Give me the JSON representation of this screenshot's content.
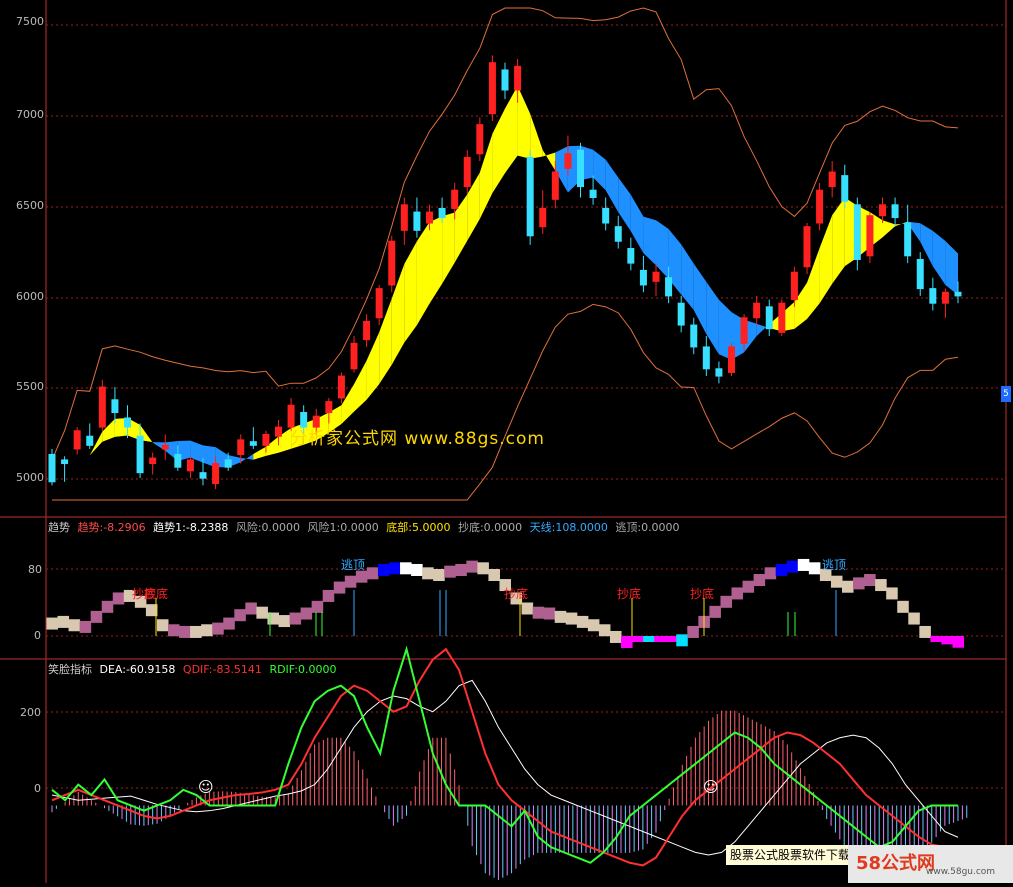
{
  "main_chart": {
    "y_ticks": [
      "7500",
      "7000",
      "6500",
      "6000",
      "5500",
      "5000"
    ],
    "watermark": "分析家公式网 www.88gs.com",
    "side_tag": "5"
  },
  "panel2": {
    "legend": {
      "title": "趋势",
      "items": [
        {
          "text": "趋势:-8.2906",
          "color": "#ff4a4a"
        },
        {
          "text": "趋势1:-8.2388",
          "color": "#ffffff"
        },
        {
          "text": "风险:0.0000",
          "color": "#aaaaaa"
        },
        {
          "text": "风险1:0.0000",
          "color": "#aaaaaa"
        },
        {
          "text": "底部:5.0000",
          "color": "#ffe000"
        },
        {
          "text": "抄底:0.0000",
          "color": "#aaaaaa"
        },
        {
          "text": "天线:108.0000",
          "color": "#33aaff"
        },
        {
          "text": "逃顶:0.0000",
          "color": "#aaaaaa"
        }
      ]
    },
    "y_ticks": [
      "80",
      "0"
    ],
    "annotations": {
      "chaodi": "抄底",
      "taoding": "逃顶"
    }
  },
  "panel3": {
    "legend": {
      "title": "笑脸指标",
      "items": [
        {
          "text": "DEA:-60.9158",
          "color": "#ffffff"
        },
        {
          "text": "QDIF:-83.5141",
          "color": "#ff3030"
        },
        {
          "text": "RDIF:0.0000",
          "color": "#33ff33"
        }
      ]
    },
    "y_ticks": [
      "200",
      "0"
    ],
    "smile": "☺"
  },
  "footer": {
    "banner": "股票公式股票软件下载",
    "logo": "58公式网",
    "url": "www.58gu.com"
  },
  "chart_data": [
    {
      "type": "candlestick",
      "title": "",
      "ylim": [
        4900,
        7600
      ],
      "candles": [
        [
          5150,
          5180,
          4980,
          5000
        ],
        [
          5120,
          5140,
          5000,
          5100
        ],
        [
          5180,
          5300,
          5150,
          5280
        ],
        [
          5250,
          5320,
          5180,
          5200
        ],
        [
          5300,
          5560,
          5280,
          5520
        ],
        [
          5450,
          5520,
          5320,
          5380
        ],
        [
          5350,
          5420,
          5240,
          5300
        ],
        [
          5250,
          5320,
          5020,
          5050
        ],
        [
          5100,
          5160,
          5040,
          5130
        ],
        [
          5180,
          5260,
          5120,
          5200
        ],
        [
          5150,
          5200,
          5060,
          5080
        ],
        [
          5060,
          5140,
          5020,
          5120
        ],
        [
          5050,
          5130,
          4980,
          5020
        ],
        [
          4990,
          5140,
          4960,
          5100
        ],
        [
          5120,
          5160,
          5060,
          5080
        ],
        [
          5150,
          5260,
          5100,
          5230
        ],
        [
          5220,
          5300,
          5180,
          5200
        ],
        [
          5200,
          5280,
          5160,
          5260
        ],
        [
          5250,
          5340,
          5200,
          5300
        ],
        [
          5300,
          5460,
          5280,
          5420
        ],
        [
          5380,
          5420,
          5260,
          5300
        ],
        [
          5300,
          5400,
          5260,
          5360
        ],
        [
          5380,
          5460,
          5320,
          5440
        ],
        [
          5460,
          5600,
          5430,
          5580
        ],
        [
          5620,
          5800,
          5600,
          5760
        ],
        [
          5780,
          5920,
          5740,
          5880
        ],
        [
          5900,
          6080,
          5860,
          6060
        ],
        [
          6080,
          6350,
          6040,
          6320
        ],
        [
          6380,
          6560,
          6300,
          6520
        ],
        [
          6480,
          6560,
          6340,
          6380
        ],
        [
          6420,
          6520,
          6380,
          6480
        ],
        [
          6500,
          6560,
          6420,
          6450
        ],
        [
          6500,
          6640,
          6440,
          6600
        ],
        [
          6620,
          6820,
          6580,
          6780
        ],
        [
          6800,
          7000,
          6760,
          6960
        ],
        [
          7020,
          7340,
          6980,
          7300
        ],
        [
          7260,
          7300,
          7100,
          7150
        ],
        [
          7150,
          7320,
          7080,
          7280
        ],
        [
          6780,
          6820,
          6300,
          6350
        ],
        [
          6400,
          6600,
          6360,
          6500
        ],
        [
          6550,
          6760,
          6500,
          6700
        ],
        [
          6720,
          6900,
          6680,
          6800
        ],
        [
          6820,
          6860,
          6560,
          6620
        ],
        [
          6600,
          6680,
          6520,
          6560
        ],
        [
          6500,
          6560,
          6380,
          6420
        ],
        [
          6400,
          6460,
          6280,
          6320
        ],
        [
          6280,
          6340,
          6160,
          6200
        ],
        [
          6160,
          6240,
          6040,
          6080
        ],
        [
          6100,
          6200,
          6020,
          6150
        ],
        [
          6120,
          6180,
          5980,
          6020
        ],
        [
          5980,
          6020,
          5820,
          5860
        ],
        [
          5860,
          5900,
          5700,
          5740
        ],
        [
          5740,
          5800,
          5580,
          5620
        ],
        [
          5620,
          5660,
          5540,
          5580
        ],
        [
          5600,
          5760,
          5580,
          5740
        ],
        [
          5760,
          5920,
          5720,
          5900
        ],
        [
          5900,
          6020,
          5860,
          5980
        ],
        [
          5960,
          6000,
          5800,
          5840
        ],
        [
          5820,
          6000,
          5800,
          5980
        ],
        [
          6000,
          6180,
          5960,
          6150
        ],
        [
          6180,
          6420,
          6140,
          6400
        ],
        [
          6420,
          6640,
          6380,
          6600
        ],
        [
          6620,
          6760,
          6560,
          6700
        ],
        [
          6680,
          6740,
          6500,
          6540
        ],
        [
          6520,
          6560,
          6160,
          6220
        ],
        [
          6240,
          6480,
          6200,
          6460
        ],
        [
          6460,
          6560,
          6420,
          6520
        ],
        [
          6520,
          6560,
          6400,
          6450
        ],
        [
          6420,
          6520,
          6200,
          6240
        ],
        [
          6220,
          6260,
          6020,
          6060
        ],
        [
          6060,
          6120,
          5940,
          5980
        ],
        [
          5980,
          6060,
          5900,
          6040
        ],
        [
          6040,
          6100,
          5980,
          6020
        ]
      ]
    },
    {
      "type": "bar",
      "title": "趋势",
      "ylim": [
        -15,
        110
      ],
      "values": [
        22,
        24,
        20,
        18,
        30,
        42,
        52,
        55,
        48,
        38,
        20,
        14,
        12,
        12,
        14,
        16,
        22,
        32,
        40,
        35,
        28,
        25,
        28,
        34,
        42,
        55,
        65,
        72,
        78,
        82,
        86,
        88,
        88,
        86,
        82,
        80,
        84,
        86,
        90,
        88,
        80,
        68,
        52,
        40,
        35,
        34,
        30,
        28,
        24,
        20,
        14,
        6,
        0,
        -6,
        -4,
        -2,
        -2,
        2,
        12,
        24,
        36,
        48,
        58,
        66,
        74,
        82,
        86,
        90,
        92,
        88,
        80,
        72,
        66,
        70,
        74,
        68,
        58,
        42,
        28,
        12,
        -2,
        -10,
        -14
      ],
      "colors": [
        "#d8c8b0",
        "#d8c8b0",
        "#d8c8b0",
        "#b06090",
        "#b06090",
        "#b06090",
        "#b06090",
        "#d8c8b0",
        "#d8c8b0",
        "#d8c8b0",
        "#d8c8b0",
        "#b06090",
        "#b06090",
        "#d8c8b0",
        "#d8c8b0",
        "#b06090",
        "#b06090",
        "#b06090",
        "#b06090",
        "#d8c8b0",
        "#d8c8b0",
        "#d8c8b0",
        "#b06090",
        "#b06090",
        "#b06090",
        "#b06090",
        "#b06090",
        "#b06090",
        "#b06090",
        "#b06090",
        "#0000ff",
        "#0000ff",
        "#ffffff",
        "#ffffff",
        "#d8c8b0",
        "#d8c8b0",
        "#b06090",
        "#b06090",
        "#b06090",
        "#d8c8b0",
        "#d8c8b0",
        "#d8c8b0",
        "#d8c8b0",
        "#d8c8b0",
        "#b06090",
        "#b06090",
        "#d8c8b0",
        "#d8c8b0",
        "#d8c8b0",
        "#d8c8b0",
        "#d8c8b0",
        "#d8c8b0",
        "#ff00ff",
        "#ff00ff",
        "#00e0ff",
        "#ff00ff",
        "#ff00ff",
        "#00e0ff",
        "#b06090",
        "#b06090",
        "#b06090",
        "#b06090",
        "#b06090",
        "#b06090",
        "#b06090",
        "#b06090",
        "#0000ff",
        "#0000ff",
        "#ffffff",
        "#ffffff",
        "#d8c8b0",
        "#d8c8b0",
        "#d8c8b0",
        "#b06090",
        "#b06090",
        "#d8c8b0",
        "#d8c8b0",
        "#d8c8b0",
        "#d8c8b0",
        "#d8c8b0",
        "#ff00ff",
        "#ff00ff",
        "#ff00ff"
      ]
    },
    {
      "type": "line",
      "title": "笑脸指标",
      "ylim": [
        -120,
        260
      ],
      "series": [
        {
          "name": "DEA",
          "color": "#ffffff",
          "values": [
            20,
            15,
            10,
            12,
            14,
            16,
            18,
            10,
            2,
            -4,
            -10,
            -12,
            -10,
            -6,
            0,
            6,
            12,
            18,
            22,
            28,
            40,
            70,
            110,
            150,
            180,
            200,
            210,
            205,
            190,
            180,
            200,
            230,
            240,
            200,
            150,
            110,
            70,
            40,
            20,
            10,
            0,
            -10,
            -20,
            -30,
            -40,
            -50,
            -60,
            -70,
            -80,
            -90,
            -95,
            -90,
            -70,
            -40,
            -10,
            20,
            50,
            80,
            100,
            120,
            130,
            135,
            130,
            110,
            80,
            40,
            10,
            -20,
            -50,
            -61
          ]
        },
        {
          "name": "QDIF",
          "color": "#ff3030",
          "values": [
            10,
            20,
            30,
            20,
            10,
            0,
            -10,
            -20,
            -25,
            -20,
            -10,
            0,
            10,
            15,
            20,
            22,
            25,
            30,
            40,
            80,
            130,
            170,
            210,
            230,
            220,
            200,
            180,
            190,
            240,
            280,
            300,
            260,
            180,
            100,
            40,
            10,
            -10,
            -30,
            -50,
            -60,
            -70,
            -80,
            -90,
            -100,
            -110,
            -115,
            -100,
            -60,
            -20,
            10,
            30,
            50,
            70,
            90,
            110,
            130,
            140,
            135,
            120,
            100,
            80,
            50,
            20,
            0,
            -20,
            -40,
            -60,
            -75,
            -80,
            -84
          ]
        },
        {
          "name": "RDIF",
          "color": "#33ff33",
          "values": [
            30,
            10,
            40,
            20,
            50,
            10,
            0,
            -10,
            0,
            10,
            30,
            20,
            0,
            0,
            0,
            0,
            0,
            0,
            80,
            150,
            200,
            220,
            230,
            210,
            150,
            100,
            220,
            300,
            200,
            100,
            40,
            0,
            0,
            0,
            -20,
            -40,
            -10,
            -60,
            -80,
            -90,
            -100,
            -110,
            -90,
            -60,
            -20,
            0,
            20,
            40,
            60,
            80,
            100,
            120,
            140,
            130,
            110,
            80,
            60,
            40,
            20,
            0,
            -20,
            -40,
            -60,
            -80,
            -70,
            -40,
            -10,
            0,
            0,
            0
          ]
        }
      ]
    }
  ]
}
